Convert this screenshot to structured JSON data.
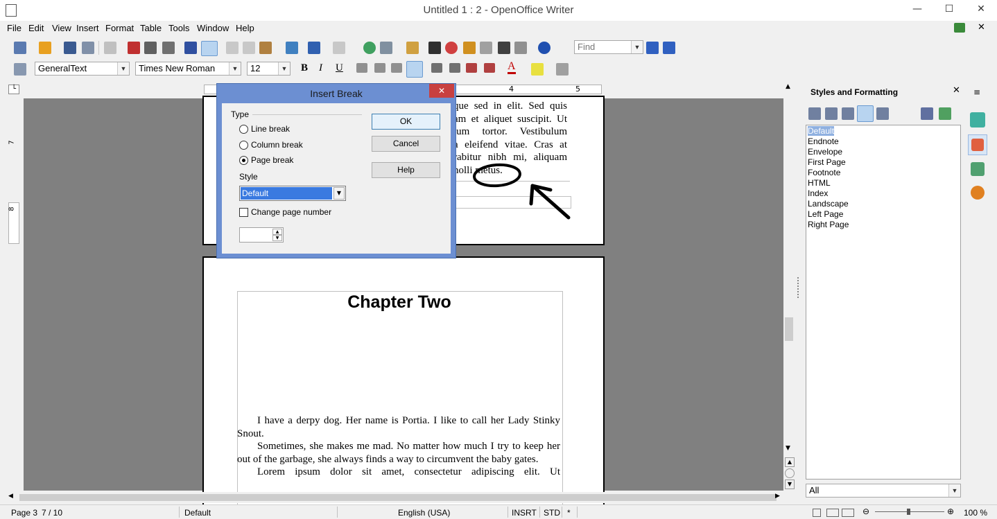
{
  "window": {
    "title": "Untitled 1 : 2 - OpenOffice Writer",
    "minimize": "—",
    "maximize": "☐",
    "close": "✕"
  },
  "menu": [
    "File",
    "Edit",
    "View",
    "Insert",
    "Format",
    "Table",
    "Tools",
    "Window",
    "Help"
  ],
  "toolbar": {
    "find_placeholder": "Find",
    "paragraph_style": "GeneralText",
    "font_name": "Times New Roman",
    "font_size": "12"
  },
  "ruler": {
    "v_marks": [
      "7",
      "8"
    ],
    "h_marks": [
      "4",
      "5"
    ]
  },
  "dialog": {
    "title": "Insert Break",
    "type_label": "Type",
    "options": [
      "Line break",
      "Column break",
      "Page break"
    ],
    "selected": "Page break",
    "style_label": "Style",
    "style_value": "Default",
    "change_page_number": "Change page number",
    "ok": "OK",
    "cancel": "Cancel",
    "help": "Help"
  },
  "document": {
    "page1_lines": [
      "que sed in elit. Sed quis",
      "am et aliquet suscipit. Ut",
      "tum tortor. Vestibulum",
      "a eleifend vitae. Cras at",
      "rabitur nibh mi, aliquam",
      "nolli metus."
    ],
    "chapter_title": "Chapter Two",
    "paragraphs": [
      "I have a derpy dog. Her name is Portia. I like to call her Lady Stinky Snout.",
      "Sometimes, she makes me mad. No matter how much I try to keep her out of the garbage, she always finds a way to circumvent the baby gates.",
      "Lorem ipsum dolor sit amet, consectetur adipiscing elit. Ut"
    ]
  },
  "sidebar": {
    "title": "Styles and Formatting",
    "styles": [
      "Default",
      "Endnote",
      "Envelope",
      "First Page",
      "Footnote",
      "HTML",
      "Index",
      "Landscape",
      "Left Page",
      "Right Page"
    ],
    "selected": "Default",
    "filter": "All"
  },
  "status": {
    "page": "Page 3",
    "page_count": "7 / 10",
    "page_style": "Default",
    "language": "English (USA)",
    "insert_mode": "INSRT",
    "selection_mode": "STD",
    "modified": "*",
    "zoom": "100 %"
  }
}
